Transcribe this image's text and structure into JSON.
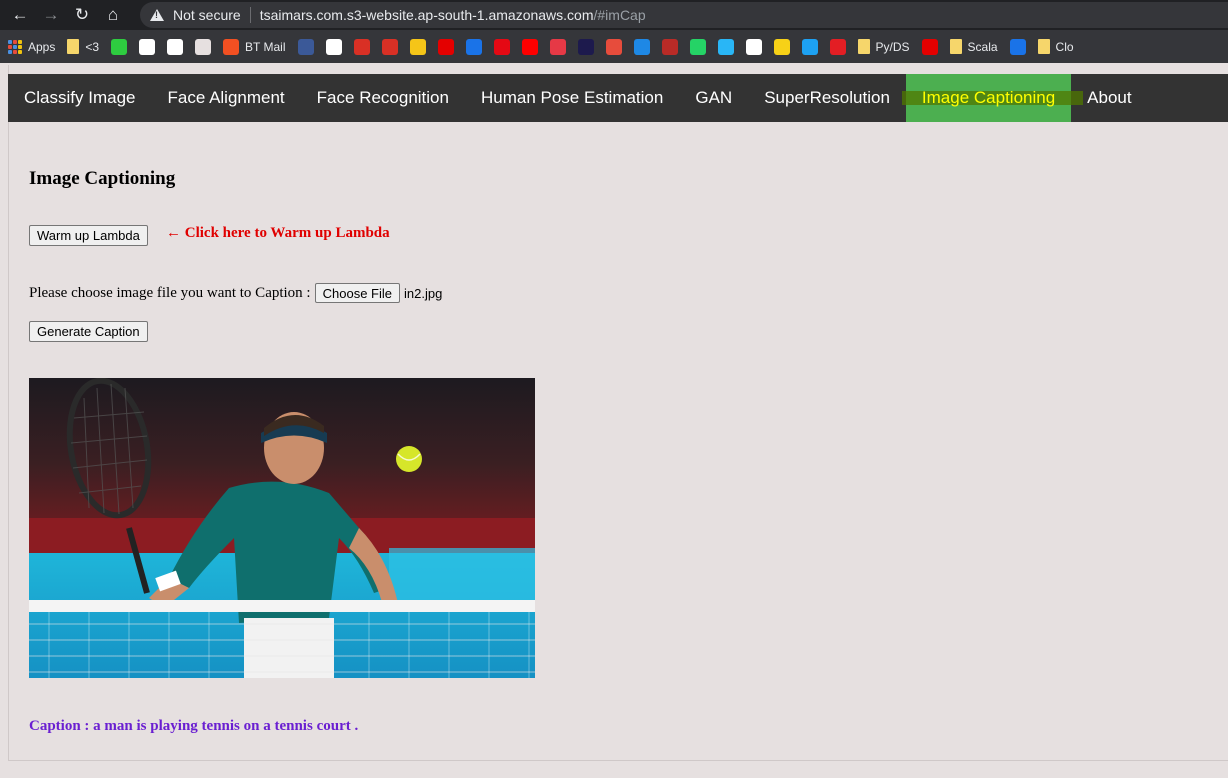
{
  "browser": {
    "security_label": "Not secure",
    "url_host": "tsaimars.com.s3-website.ap-south-1.amazonaws.com",
    "url_hash": "/#imCap"
  },
  "bookmarks": [
    {
      "icon": "apps-icon",
      "label": "Apps"
    },
    {
      "icon": "folder-icon",
      "label": "<3"
    },
    {
      "icon": "code-icon",
      "label": ""
    },
    {
      "icon": "globe-icon",
      "label": ""
    },
    {
      "icon": "wikipedia-icon",
      "label": ""
    },
    {
      "icon": "bookmark-icon",
      "label": ""
    },
    {
      "icon": "microsoft-icon",
      "label": "BT Mail"
    },
    {
      "icon": "facebook-icon",
      "label": ""
    },
    {
      "icon": "google-icon",
      "label": ""
    },
    {
      "icon": "gmail-icon",
      "label": ""
    },
    {
      "icon": "gmail-alt-icon",
      "label": ""
    },
    {
      "icon": "imdb-icon",
      "label": ""
    },
    {
      "icon": "airtel-icon",
      "label": ""
    },
    {
      "icon": "play-icon",
      "label": ""
    },
    {
      "icon": "netflix-icon",
      "label": ""
    },
    {
      "icon": "youtube-icon",
      "label": ""
    },
    {
      "icon": "link-icon",
      "label": ""
    },
    {
      "icon": "dh-icon",
      "label": ""
    },
    {
      "icon": "x-icon",
      "label": ""
    },
    {
      "icon": "ntp-icon",
      "label": ""
    },
    {
      "icon": "quora-icon",
      "label": ""
    },
    {
      "icon": "whatsapp-icon",
      "label": ""
    },
    {
      "icon": "circle-icon",
      "label": ""
    },
    {
      "icon": "amazon-icon",
      "label": ""
    },
    {
      "icon": "flipkart-icon",
      "label": ""
    },
    {
      "icon": "twitter-icon",
      "label": ""
    },
    {
      "icon": "es-icon",
      "label": ""
    },
    {
      "icon": "folder-icon",
      "label": "Py/DS"
    },
    {
      "icon": "airtel-icon",
      "label": ""
    },
    {
      "icon": "folder-icon",
      "label": "Scala"
    },
    {
      "icon": "colab-icon",
      "label": ""
    },
    {
      "icon": "folder-icon",
      "label": "Clo"
    }
  ],
  "menu": [
    {
      "label": "Classify Image",
      "active": false
    },
    {
      "label": "Face Alignment",
      "active": false
    },
    {
      "label": "Face Recognition",
      "active": false
    },
    {
      "label": "Human Pose Estimation",
      "active": false
    },
    {
      "label": "GAN",
      "active": false
    },
    {
      "label": "SuperResolution",
      "active": false
    },
    {
      "label": "Image Captioning",
      "active": true
    },
    {
      "label": "About",
      "active": false
    }
  ],
  "page": {
    "title": "Image Captioning",
    "warmup_button": "Warm up Lambda",
    "warmup_hint": "← Click here to Warm up Lambda",
    "choose_label": "Please choose image file you want to Caption :",
    "choose_button": "Choose File",
    "file_name": "in2.jpg",
    "generate_button": "Generate Caption",
    "caption": "Caption : a man is playing tennis on a tennis court ."
  },
  "colors": {
    "menu_bg": "#333333",
    "active_bg": "#4caf50",
    "active_text": "#ffff00",
    "hint": "#e00000",
    "caption": "#6a1fd1"
  }
}
